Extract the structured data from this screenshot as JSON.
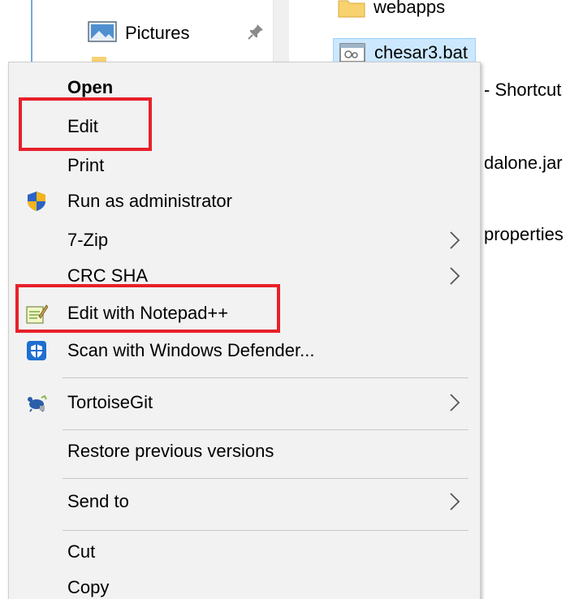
{
  "navigation": {
    "item": {
      "label": "Pictures",
      "icon": "pictures-folder-icon",
      "pin_icon": "pin-icon"
    }
  },
  "files": {
    "webapps": {
      "name": "webapps",
      "icon": "folder-icon"
    },
    "selected": {
      "name": "chesar3.bat",
      "icon": "batch-file-icon"
    },
    "peeks": [
      " - Shortcut",
      "dalone.jar",
      "properties"
    ]
  },
  "context_menu": {
    "items": {
      "open": "Open",
      "edit": "Edit",
      "print": "Print",
      "run_as_admin": "Run as administrator",
      "seven_zip": "7-Zip",
      "crc_sha": "CRC SHA",
      "edit_notepadpp": "Edit with Notepad++",
      "scan_defender": "Scan with Windows Defender...",
      "tortoisegit": "TortoiseGit",
      "restore_versions": "Restore previous versions",
      "send_to": "Send to",
      "cut": "Cut",
      "copy": "Copy"
    }
  },
  "colors": {
    "highlight_box": "#e8202a",
    "selection": "#cce8ff",
    "menu_background": "#f2f2f2"
  }
}
